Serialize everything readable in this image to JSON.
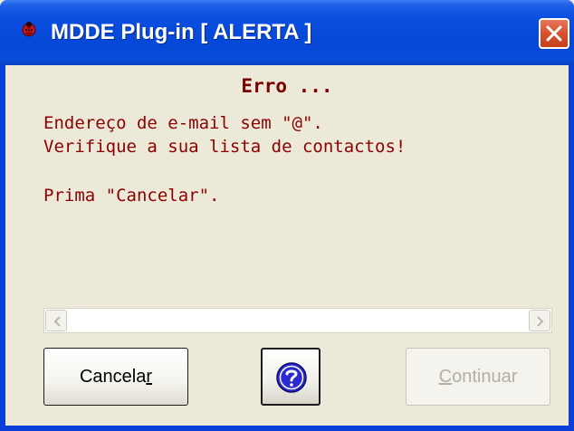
{
  "window": {
    "title": "MDDE Plug-in [ ALERTA ]"
  },
  "dialog": {
    "heading": "Erro ...",
    "message_line1": "Endereço de e-mail sem \"@\".",
    "message_line2": "Verifique a sua lista de contactos!",
    "message_line3": "Prima \"Cancelar\"."
  },
  "buttons": {
    "cancel_label_main": "Cancela",
    "cancel_label_mnemonic": "r",
    "help_icon": "question-icon",
    "continue_label_mnemonic": "C",
    "continue_label_main": "ontinuar"
  },
  "colors": {
    "titlebar": "#0a4ee0",
    "message_text": "#8b0000",
    "close_button": "#d9512c"
  }
}
